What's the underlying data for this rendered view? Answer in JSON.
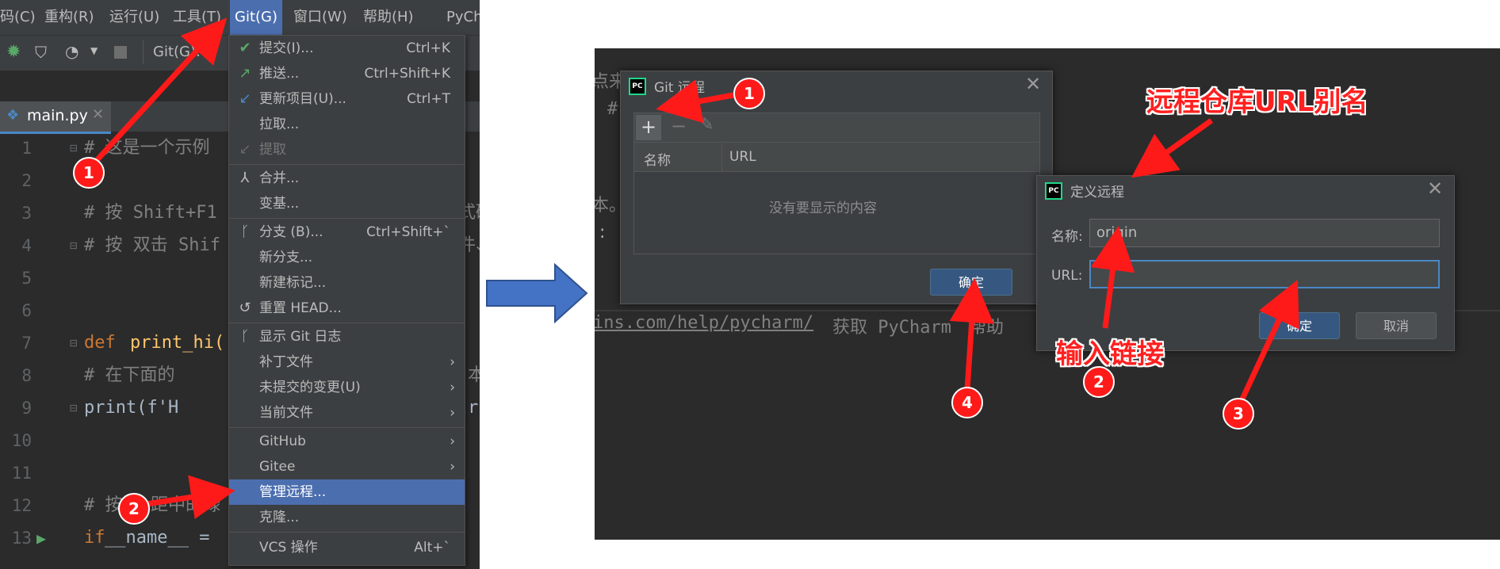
{
  "ide": {
    "menubar": [
      {
        "label": "码(C)"
      },
      {
        "label": "重构(R)"
      },
      {
        "label": "运行(U)"
      },
      {
        "label": "工具(T)"
      },
      {
        "label": "Git(G)"
      },
      {
        "label": "窗口(W)"
      },
      {
        "label": "帮助(H)"
      },
      {
        "label": "PyCh"
      }
    ],
    "toolbar": {
      "git_label": "Git(G):"
    },
    "tab": {
      "label": "main.py"
    },
    "editor_lines": [
      {
        "num": "1",
        "text": "# 这是一个示例"
      },
      {
        "num": "2",
        "text": ""
      },
      {
        "num": "3",
        "text": "# 按 Shift+F1",
        "tail": "式码"
      },
      {
        "num": "4",
        "text": "# 按 双击 Shif",
        "tail": "件、"
      },
      {
        "num": "5",
        "text": ""
      },
      {
        "num": "6",
        "text": ""
      },
      {
        "num": "7",
        "kw": "def",
        "fn": "print_hi(",
        "text": ""
      },
      {
        "num": "8",
        "text": "    # 在下面的",
        "tail": "本"
      },
      {
        "num": "9",
        "text": "    print(f'H",
        "tail": "r"
      },
      {
        "num": "10",
        "text": ""
      },
      {
        "num": "11",
        "text": ""
      },
      {
        "num": "12",
        "text": "# 按",
        "mid": "距中的绿"
      },
      {
        "num": "13",
        "kw": "if",
        "text": " __name__ ="
      }
    ]
  },
  "git_menu": {
    "items": [
      {
        "label": "提交(I)...",
        "shortcut": "Ctrl+K",
        "icon": "check-icon"
      },
      {
        "label": "推送...",
        "shortcut": "Ctrl+Shift+K",
        "icon": "push-arrow-icon"
      },
      {
        "label": "更新项目(U)...",
        "shortcut": "Ctrl+T",
        "icon": "update-arrow-icon"
      },
      {
        "label": "拉取...",
        "shortcut": ""
      },
      {
        "label": "提取",
        "shortcut": "",
        "disabled": true,
        "icon": "fetch-icon"
      },
      {
        "label": "合并...",
        "shortcut": "",
        "icon": "merge-icon"
      },
      {
        "label": "变基...",
        "shortcut": ""
      },
      {
        "label": "分支 (B)...",
        "shortcut": "Ctrl+Shift+`",
        "icon": "branch-icon"
      },
      {
        "label": "新分支...",
        "shortcut": ""
      },
      {
        "label": "新建标记...",
        "shortcut": ""
      },
      {
        "label": "重置 HEAD...",
        "shortcut": "",
        "icon": "reset-icon"
      },
      {
        "label": "显示 Git 日志",
        "shortcut": "",
        "icon": "log-icon"
      },
      {
        "label": "补丁文件",
        "submenu": true
      },
      {
        "label": "未提交的变更(U)",
        "submenu": true
      },
      {
        "label": "当前文件",
        "submenu": true
      },
      {
        "label": "GitHub",
        "submenu": true
      },
      {
        "label": "Gitee",
        "submenu": true
      },
      {
        "label": "管理远程...",
        "highlighted": true
      },
      {
        "label": "克隆..."
      },
      {
        "label": "VCS 操作",
        "shortcut": "Alt+`"
      }
    ]
  },
  "right": {
    "bg_fragments": {
      "top_left": "点来",
      "hash": "#",
      "dot": "本。",
      "colon": ":",
      "url_line": "ins.com/help/pycharm/",
      "url_tail": "获取 PyCharm",
      "url_tail2": "帮助"
    },
    "git_remote_dialog": {
      "title": "Git 远程",
      "col_name": "名称",
      "col_url": "URL",
      "empty": "没有要显示的内容",
      "ok": "确定"
    },
    "define_remote_dialog": {
      "title": "定义远程",
      "name_label": "名称:",
      "name_value": "origin",
      "url_label": "URL:",
      "url_value": "",
      "ok": "确定",
      "cancel": "取消"
    }
  },
  "annotations": {
    "left_badge_1": "1",
    "left_badge_2": "2",
    "right_badge_1": "1",
    "right_badge_2": "2",
    "right_badge_3": "3",
    "right_badge_4": "4",
    "alias_text": "远程仓库URL别名",
    "input_text": "输入链接"
  },
  "colors": {
    "annotation_red": "#ff1a1a",
    "highlight_blue": "#4b6eaf",
    "arrow_blue": "#4472c4"
  }
}
